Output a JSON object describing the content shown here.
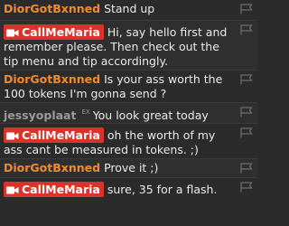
{
  "messages": [
    {
      "user": "DiorGotBxnned",
      "text": "Stand up"
    },
    {
      "user": "CallMeMaria",
      "text": "Hi, say hello first and remember please. Then check out the tip menu and tip accordingly."
    },
    {
      "user": "DiorGotBxnned",
      "text": "Is your ass worth the 100 tokens I'm gonna send ?"
    },
    {
      "user": "jessyoplaat",
      "sup": "EX",
      "text": "You look great today"
    },
    {
      "user": "CallMeMaria",
      "text": "oh the worth of my ass cant be measured in tokens. ;)"
    },
    {
      "user": "DiorGotBxnned",
      "text": "Prove it ;)"
    },
    {
      "user": "CallMeMaria",
      "text": "sure, 35 for a flash."
    }
  ],
  "colors": {
    "background": "#2b2b2b",
    "username": "#ef8a2f",
    "broadcaster_badge": "#d9342c",
    "text": "#ebebeb"
  },
  "icons": {
    "report": "flag-icon",
    "broadcaster": "camera-icon"
  }
}
